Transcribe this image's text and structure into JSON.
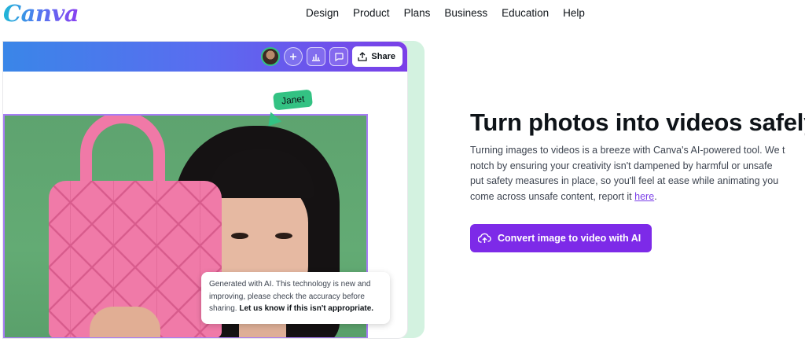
{
  "brand": {
    "logo_text": "Canva",
    "accent": "#7d2ae8"
  },
  "nav": {
    "items": [
      "Design",
      "Product",
      "Plans",
      "Business",
      "Education",
      "Help"
    ]
  },
  "editor": {
    "share_label": "Share",
    "collaborator_label": "Janet",
    "ai_note": {
      "text": "Generated with AI. This technology is new and improving, please check the accuracy before sharing.",
      "link": "Let us know if this isn't appropriate."
    }
  },
  "hero": {
    "title": "Turn photos into videos safely",
    "body_lines": [
      "Turning images to videos is a breeze with Canva's AI-powered tool. We t",
      "notch by ensuring your creativity isn't dampened by harmful or unsafe",
      "put safety measures in place, so you'll feel at ease while animating you",
      "come across unsafe content, report it"
    ],
    "body_link": "here",
    "cta_label": "Convert image to video with AI"
  }
}
